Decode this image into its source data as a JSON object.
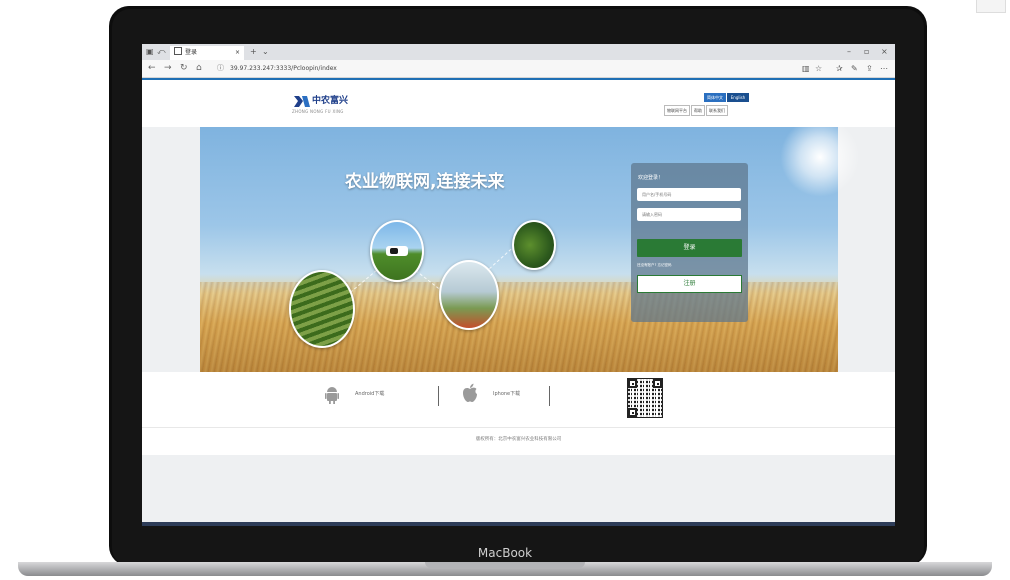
{
  "browser": {
    "tab_title": "登录",
    "url": "39.97.233.247:3333/Pcloopin/index",
    "device_brand": "MacBook"
  },
  "header": {
    "logo_cn": "中农富兴",
    "logo_en": "ZHONG NONG FU XING",
    "lang_cn": "简体中文",
    "lang_en": "English",
    "links": [
      "物联网平台",
      "帮助",
      "联系我们"
    ]
  },
  "banner": {
    "slogan": "农业物联网,连接未来"
  },
  "login": {
    "title": "欢迎登录！",
    "username_placeholder": "用户名/手机号码",
    "password_placeholder": "请输入密码",
    "login_button": "登录",
    "links_text": "还没有账户? 忘记密码",
    "register_button": "注册"
  },
  "downloads": {
    "android_label": "Android下载",
    "iphone_label": "Iphone下载"
  },
  "footer": {
    "copyright": "版权所有：北京中农富兴农业科技有限公司"
  },
  "colors": {
    "accent_blue": "#1f6fb4",
    "login_green": "#2a7a35",
    "logo_blue": "#1f3f8a"
  }
}
